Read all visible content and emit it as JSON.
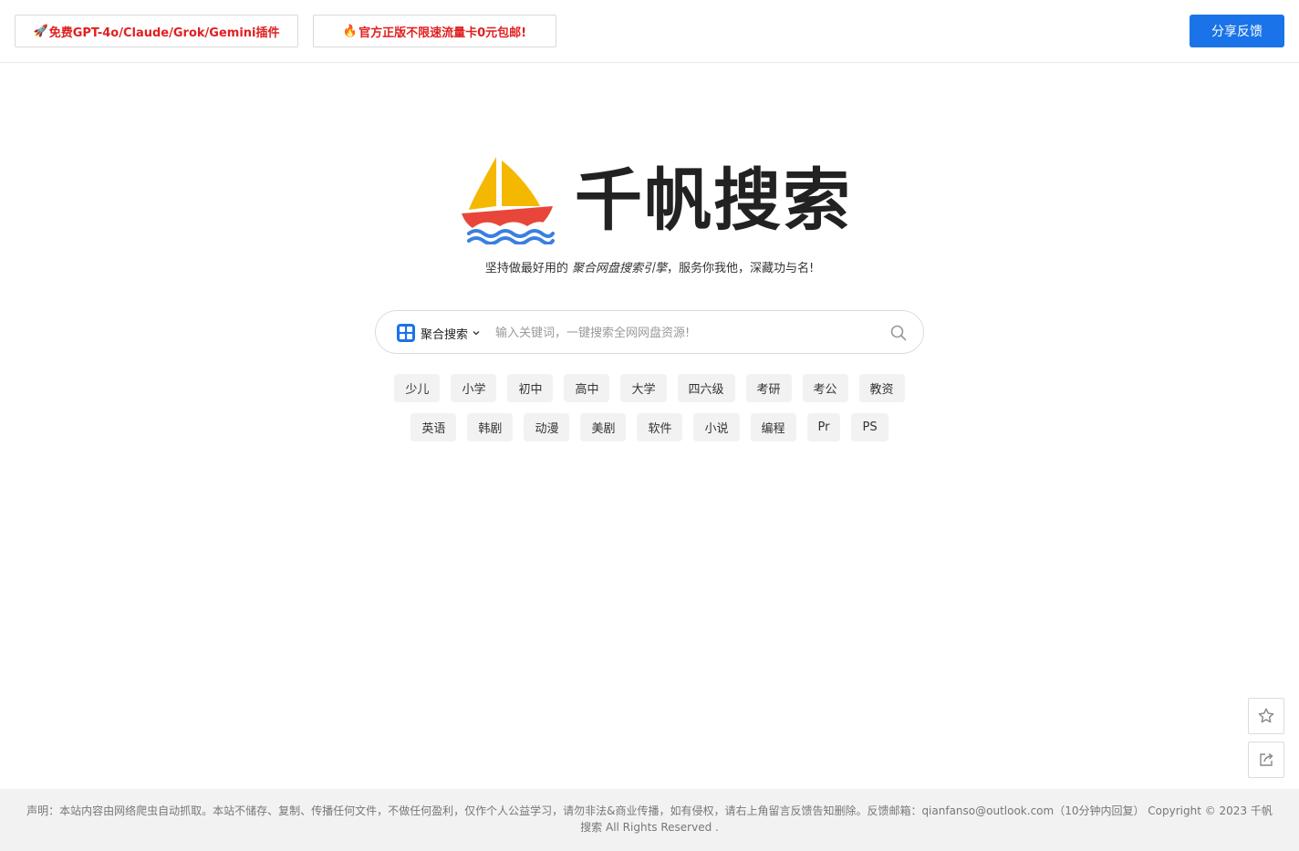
{
  "header": {
    "promo_1": {
      "emoji": "🚀",
      "label": "免费GPT-4o/Claude/Grok/Gemini插件"
    },
    "promo_2": {
      "emoji": "🔥",
      "label": "官方正版不限速流量卡0元包邮!"
    },
    "feedback_label": "分享反馈"
  },
  "logo": {
    "text": "千帆搜索"
  },
  "tagline": {
    "before": "坚持做最好用的 ",
    "emphasis": "聚合网盘搜索引擎",
    "after": "，服务你我他，深藏功与名!"
  },
  "search": {
    "type_label": "聚合搜索",
    "placeholder": "输入关键词，一键搜索全网网盘资源!",
    "value": ""
  },
  "tags_row1": [
    "少儿",
    "小学",
    "初中",
    "高中",
    "大学",
    "四六级",
    "考研",
    "考公",
    "教资"
  ],
  "tags_row2": [
    "英语",
    "韩剧",
    "动漫",
    "美剧",
    "软件",
    "小说",
    "编程",
    "Pr",
    "PS"
  ],
  "footer": {
    "text": "声明：本站内容由网络爬虫自动抓取。本站不储存、复制、传播任何文件，不做任何盈利，仅作个人公益学习，请勿非法&商业传播，如有侵权，请右上角留言反馈告知删除。反馈邮箱：qianfanso@outlook.com（10分钟内回复） Copyright © 2023 千帆搜索 All Rights Reserved ."
  },
  "colors": {
    "accent": "#1a73e8",
    "promo_text": "#e02020",
    "sail": "#f5b800",
    "hull": "#e8463a",
    "waves": "#3a7fe0"
  },
  "icons": {
    "search_type": "grid-icon",
    "dropdown": "chevron-down-icon",
    "search": "search-icon",
    "favorite": "star-icon",
    "share": "share-icon"
  }
}
